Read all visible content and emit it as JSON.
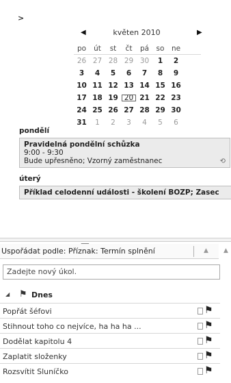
{
  "calendar": {
    "expand_glyph": ">",
    "prev_glyph": "◀",
    "next_glyph": "▶",
    "month_title": "květen 2010",
    "weekdays": [
      "po",
      "út",
      "st",
      "čt",
      "pá",
      "so",
      "ne"
    ],
    "weeks": [
      [
        {
          "d": "26",
          "t": "other"
        },
        {
          "d": "27",
          "t": "other"
        },
        {
          "d": "28",
          "t": "other"
        },
        {
          "d": "29",
          "t": "other"
        },
        {
          "d": "30",
          "t": "other"
        },
        {
          "d": "1",
          "t": "cur"
        },
        {
          "d": "2",
          "t": "cur"
        }
      ],
      [
        {
          "d": "3",
          "t": "cur"
        },
        {
          "d": "4",
          "t": "cur"
        },
        {
          "d": "5",
          "t": "cur"
        },
        {
          "d": "6",
          "t": "cur"
        },
        {
          "d": "7",
          "t": "cur"
        },
        {
          "d": "8",
          "t": "cur"
        },
        {
          "d": "9",
          "t": "cur"
        }
      ],
      [
        {
          "d": "10",
          "t": "cur"
        },
        {
          "d": "11",
          "t": "cur"
        },
        {
          "d": "12",
          "t": "cur"
        },
        {
          "d": "13",
          "t": "cur"
        },
        {
          "d": "14",
          "t": "cur"
        },
        {
          "d": "15",
          "t": "cur"
        },
        {
          "d": "16",
          "t": "cur"
        }
      ],
      [
        {
          "d": "17",
          "t": "cur"
        },
        {
          "d": "18",
          "t": "cur"
        },
        {
          "d": "19",
          "t": "cur"
        },
        {
          "d": "20",
          "t": "sel"
        },
        {
          "d": "21",
          "t": "cur"
        },
        {
          "d": "22",
          "t": "cur"
        },
        {
          "d": "23",
          "t": "cur"
        }
      ],
      [
        {
          "d": "24",
          "t": "cur"
        },
        {
          "d": "25",
          "t": "cur"
        },
        {
          "d": "26",
          "t": "cur"
        },
        {
          "d": "27",
          "t": "cur"
        },
        {
          "d": "28",
          "t": "cur"
        },
        {
          "d": "29",
          "t": "cur"
        },
        {
          "d": "30",
          "t": "cur"
        }
      ],
      [
        {
          "d": "31",
          "t": "cur"
        },
        {
          "d": "1",
          "t": "other"
        },
        {
          "d": "2",
          "t": "other"
        },
        {
          "d": "3",
          "t": "other"
        },
        {
          "d": "4",
          "t": "other"
        },
        {
          "d": "5",
          "t": "other"
        },
        {
          "d": "6",
          "t": "other"
        }
      ]
    ]
  },
  "agenda": {
    "day1_label": "pondělí",
    "event1": {
      "title": "Pravidelná pondělní schůzka",
      "time": "9:00 - 9:30",
      "detail": "Bude upřesněno; Vzorný zaměstnanec",
      "recur_icon": "recurrence-icon"
    },
    "day2_label": "úterý",
    "event2": {
      "title": "Příklad celodenní události - školení BOZP; Zasec"
    }
  },
  "tasks": {
    "sort_label": "Uspořádat podle: Příznak: Termín splnění",
    "sort_glyph": "▲",
    "new_task_placeholder": "Zadejte nový úkol.",
    "group_label": "Dnes",
    "group_glyph": "◢",
    "flag_glyph": "🏴",
    "items": [
      "Popřát šéfovi",
      "Stihnout toho co nejvíce, ha ha ha ...",
      "Dodělat kapitolu 4",
      "Zaplatit složenky",
      "Rozsvítit Sluníčko"
    ]
  },
  "colors": {
    "event_bg": "#ebebeb",
    "border": "#bdbdbd"
  }
}
